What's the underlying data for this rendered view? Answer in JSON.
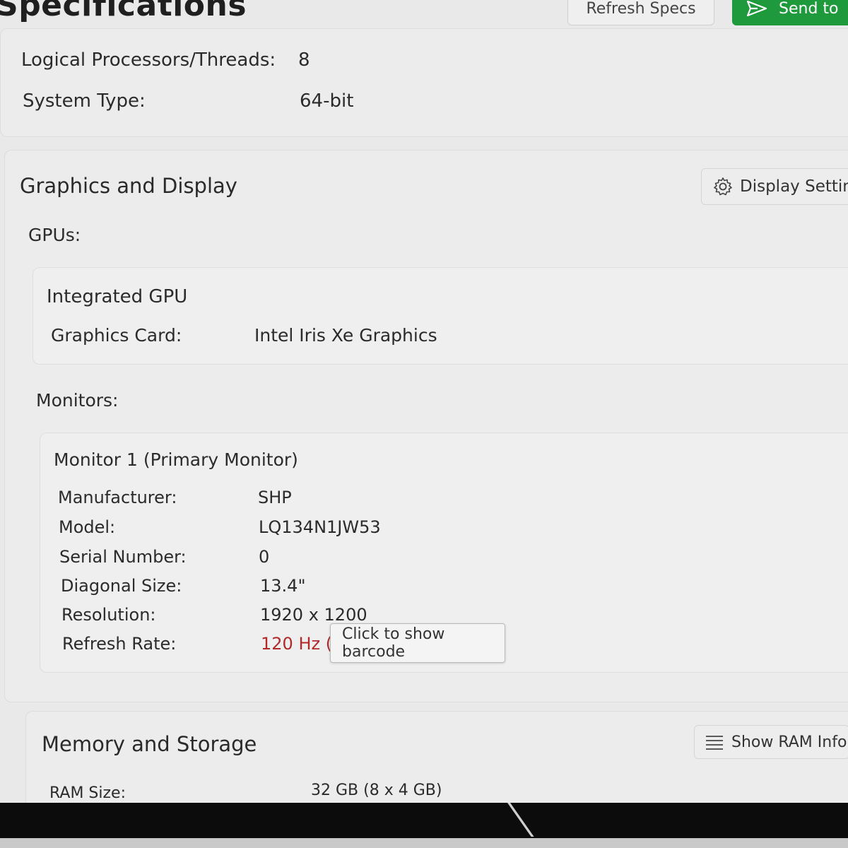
{
  "header": {
    "title": "Specifications",
    "refresh_label": "Refresh Specs",
    "send_label": "Send to",
    "send_icon": "send-icon",
    "accent_color": "#1e9a3c"
  },
  "cpu": {
    "threads_label": "Logical Processors/Threads:",
    "threads_value": "8",
    "system_type_label": "System Type:",
    "system_type_value": "64-bit"
  },
  "graphics": {
    "title": "Graphics and Display",
    "display_settings_label": "Display Setting",
    "display_settings_icon": "gear-icon",
    "gpus_heading": "GPUs:",
    "gpu": {
      "name": "Integrated GPU",
      "card_label": "Graphics Card:",
      "card_value": "Intel Iris Xe Graphics"
    },
    "monitors_heading": "Monitors:",
    "monitor": {
      "name": "Monitor 1 (Primary Monitor)",
      "rows": [
        {
          "label": "Manufacturer:",
          "value": "SHP"
        },
        {
          "label": "Model:",
          "value": "LQ134N1JW53"
        },
        {
          "label": "Serial Number:",
          "value": "0"
        },
        {
          "label": "Diagonal Size:",
          "value": "13.4\""
        },
        {
          "label": "Resolution:",
          "value": "1920 x 1200"
        },
        {
          "label": "Refresh Rate:",
          "value": "120 Hz (I"
        }
      ],
      "refresh_rate_color": "#b22a2a"
    },
    "tooltip": "Click to show barcode"
  },
  "memory": {
    "title": "Memory and Storage",
    "show_ram_label": "Show RAM Info",
    "show_ram_icon": "list-icon",
    "ram_label": "RAM Size:",
    "ram_value": "32 GB (8 x 4 GB)"
  }
}
